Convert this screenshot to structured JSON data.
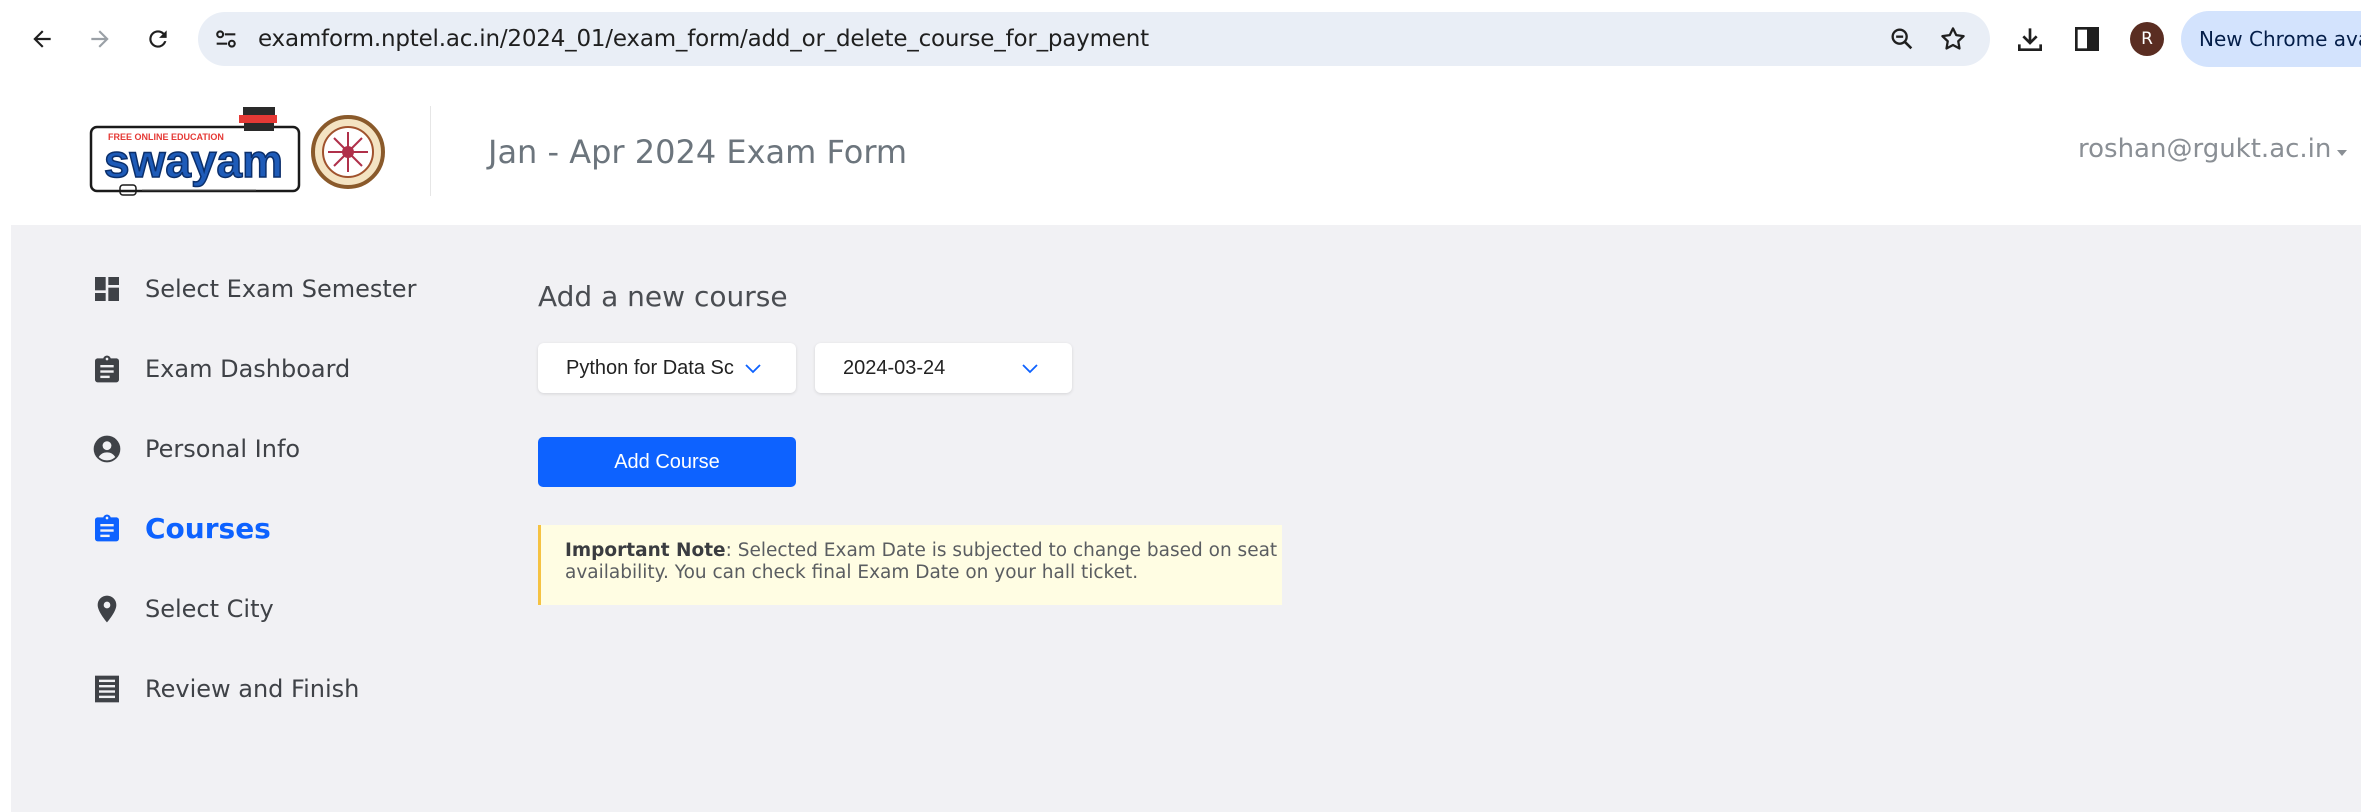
{
  "browser": {
    "url": "examform.nptel.ac.in/2024_01/exam_form/add_or_delete_course_for_payment",
    "profile_initial": "R",
    "update_label": "New Chrome available"
  },
  "header": {
    "logo_alt": "SWAYAM",
    "title": "Jan - Apr 2024 Exam Form",
    "user_email": "roshan@rgukt.ac.in"
  },
  "sidebar": {
    "items": [
      {
        "label": "Select Exam Semester",
        "icon": "dashboard-icon"
      },
      {
        "label": "Exam Dashboard",
        "icon": "clipboard-icon"
      },
      {
        "label": "Personal Info",
        "icon": "account-circle-icon"
      },
      {
        "label": "Courses",
        "icon": "clipboard-list-icon",
        "active": true
      },
      {
        "label": "Select City",
        "icon": "location-pin-icon"
      },
      {
        "label": "Review and Finish",
        "icon": "receipt-icon"
      }
    ]
  },
  "main": {
    "add_title": "Add a new course",
    "course_select": "Python for Data Science",
    "date_select": "2024-03-24",
    "add_button": "Add Course",
    "note_label": "Important Note",
    "note_text": ": Selected Exam Date is subjected to change based on seat availability. You can check final Exam Date on your hall ticket."
  },
  "colors": {
    "accent": "#0d62ff",
    "note_bg": "#fffde3",
    "note_border": "#f5c242",
    "main_bg": "#f1f1f4"
  }
}
